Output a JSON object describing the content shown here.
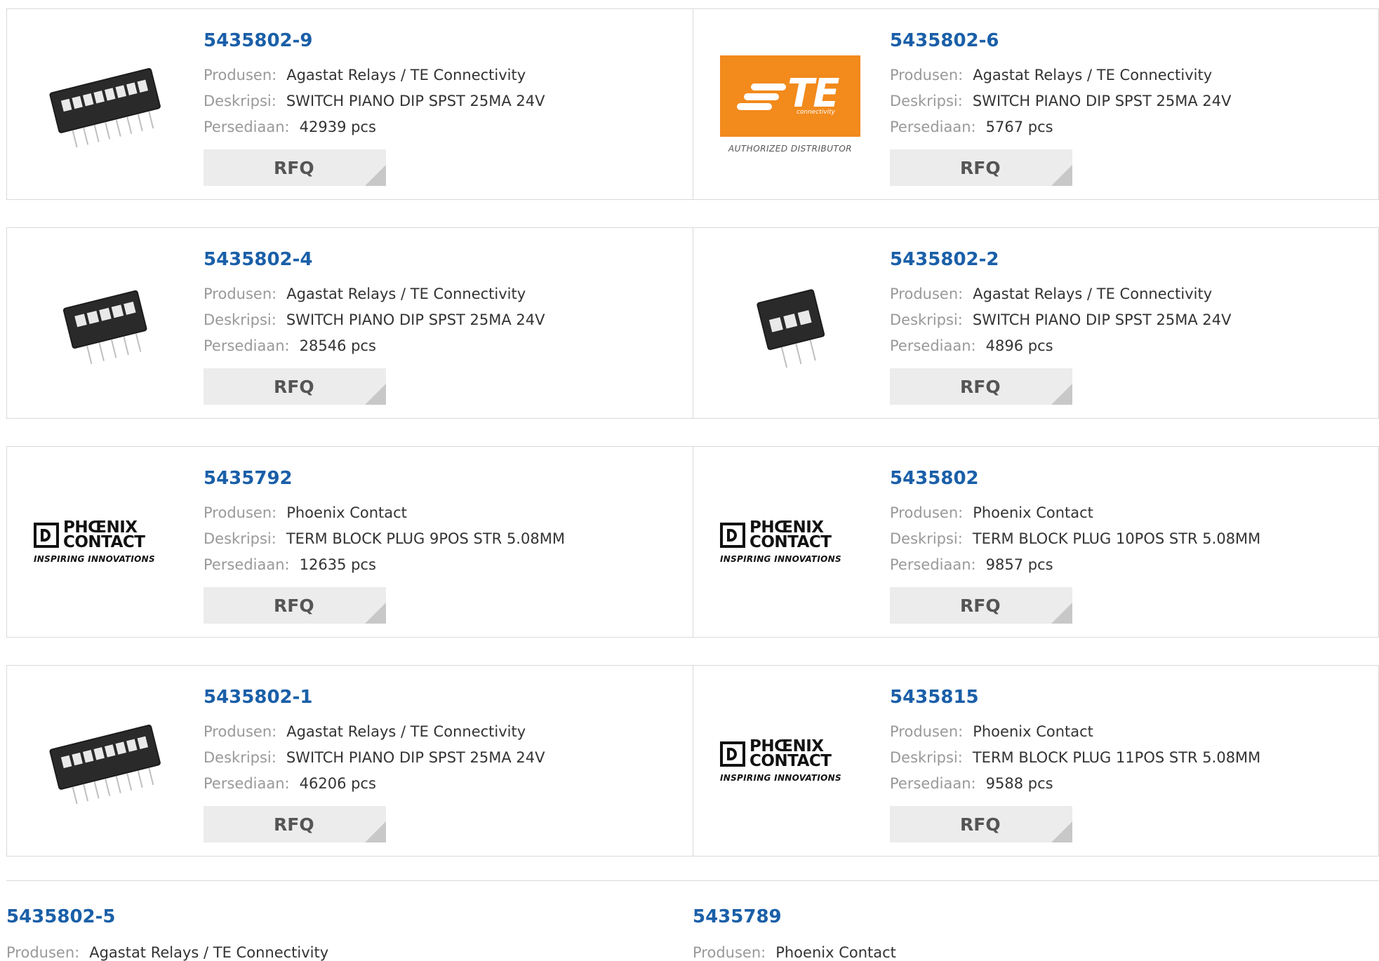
{
  "rfq_label": "RFQ",
  "labels": {
    "manufacturer": "Produsen:",
    "description": "Deskripsi:",
    "stock": "Persediaan:"
  },
  "logos": {
    "te": {
      "text": "TE",
      "subtext": "connectivity",
      "caption": "AUTHORIZED DISTRIBUTOR",
      "color": "#f28a1c"
    },
    "phoenix": {
      "line1": "PHŒNIX",
      "line2": "CONTACT",
      "tagline": "INSPIRING INNOVATIONS"
    }
  },
  "products": [
    {
      "part": "5435802-9",
      "manufacturer": "Agastat Relays / TE Connectivity",
      "description": "SWITCH PIANO DIP SPST 25MA 24V",
      "stock": "42939 pcs",
      "image": "dip-switch-8"
    },
    {
      "part": "5435802-6",
      "manufacturer": "Agastat Relays / TE Connectivity",
      "description": "SWITCH PIANO DIP SPST 25MA 24V",
      "stock": "5767 pcs",
      "image": "te-logo"
    },
    {
      "part": "5435802-4",
      "manufacturer": "Agastat Relays / TE Connectivity",
      "description": "SWITCH PIANO DIP SPST 25MA 24V",
      "stock": "28546 pcs",
      "image": "dip-switch-5"
    },
    {
      "part": "5435802-2",
      "manufacturer": "Agastat Relays / TE Connectivity",
      "description": "SWITCH PIANO DIP SPST 25MA 24V",
      "stock": "4896 pcs",
      "image": "dip-switch-3"
    },
    {
      "part": "5435792",
      "manufacturer": "Phoenix Contact",
      "description": "TERM BLOCK PLUG 9POS STR 5.08MM",
      "stock": "12635 pcs",
      "image": "phoenix-logo"
    },
    {
      "part": "5435802",
      "manufacturer": "Phoenix Contact",
      "description": "TERM BLOCK PLUG 10POS STR 5.08MM",
      "stock": "9857 pcs",
      "image": "phoenix-logo"
    },
    {
      "part": "5435802-1",
      "manufacturer": "Agastat Relays / TE Connectivity",
      "description": "SWITCH PIANO DIP SPST 25MA 24V",
      "stock": "46206 pcs",
      "image": "dip-switch-8"
    },
    {
      "part": "5435815",
      "manufacturer": "Phoenix Contact",
      "description": "TERM BLOCK PLUG 11POS STR 5.08MM",
      "stock": "9588 pcs",
      "image": "phoenix-logo"
    },
    {
      "part": "5435802-5",
      "manufacturer": "Agastat Relays / TE Connectivity"
    },
    {
      "part": "5435789",
      "manufacturer": "Phoenix Contact"
    }
  ]
}
